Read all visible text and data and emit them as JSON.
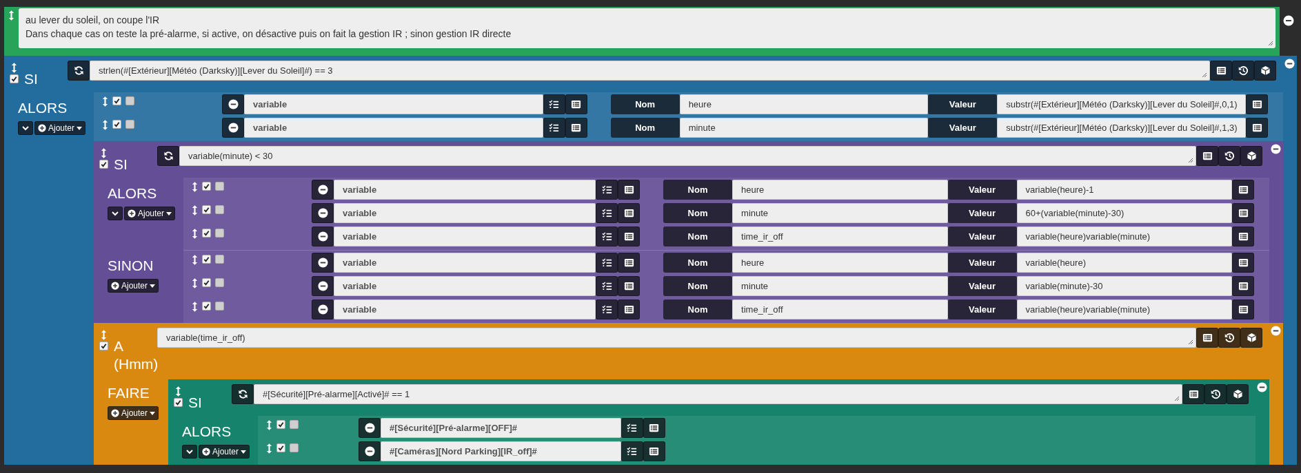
{
  "blocks": [
    {
      "kind": "comment",
      "color": "#27a35a",
      "lines": [
        "au lever du soleil, on coupe l'IR",
        "Dans chaque cas on teste la pré-alarme, si active, on désactive puis on fait la gestion IR ; sinon gestion IR directe"
      ]
    },
    {
      "kind": "if",
      "color": "#236c9e",
      "label": "SI",
      "enabled": true,
      "expression": "strlen(#[Extérieur][Météo (Darksky)][Lever du Soleil]#) == 3",
      "sections": [
        {
          "label": "ALORS",
          "collapse_button": true,
          "add_button": "Ajouter",
          "items": [
            {
              "kind": "action",
              "enabled": true,
              "parallel": false,
              "command": "variable",
              "name_label": "Nom",
              "name": "heure",
              "value_label": "Valeur",
              "value": "substr(#[Extérieur][Météo (Darksky)][Lever du Soleil]#,0,1)"
            },
            {
              "kind": "action",
              "enabled": true,
              "parallel": false,
              "command": "variable",
              "name_label": "Nom",
              "name": "minute",
              "value_label": "Valeur",
              "value": "substr(#[Extérieur][Météo (Darksky)][Lever du Soleil]#,1,3)"
            },
            {
              "kind": "if",
              "color": "#644e96",
              "label": "SI",
              "enabled": true,
              "expression": "variable(minute) < 30",
              "sections": [
                {
                  "label": "ALORS",
                  "collapse_button": true,
                  "add_button": "Ajouter",
                  "items": [
                    {
                      "kind": "action",
                      "enabled": true,
                      "parallel": false,
                      "command": "variable",
                      "name_label": "Nom",
                      "name": "heure",
                      "value_label": "Valeur",
                      "value": "variable(heure)-1"
                    },
                    {
                      "kind": "action",
                      "enabled": true,
                      "parallel": false,
                      "command": "variable",
                      "name_label": "Nom",
                      "name": "minute",
                      "value_label": "Valeur",
                      "value": "60+(variable(minute)-30)"
                    },
                    {
                      "kind": "action",
                      "enabled": true,
                      "parallel": false,
                      "command": "variable",
                      "name_label": "Nom",
                      "name": "time_ir_off",
                      "value_label": "Valeur",
                      "value": "variable(heure)variable(minute)"
                    }
                  ]
                },
                {
                  "label": "SINON",
                  "collapse_button": false,
                  "add_button": "Ajouter",
                  "items": [
                    {
                      "kind": "action",
                      "enabled": true,
                      "parallel": false,
                      "command": "variable",
                      "name_label": "Nom",
                      "name": "heure",
                      "value_label": "Valeur",
                      "value": "variable(heure)"
                    },
                    {
                      "kind": "action",
                      "enabled": true,
                      "parallel": false,
                      "command": "variable",
                      "name_label": "Nom",
                      "name": "minute",
                      "value_label": "Valeur",
                      "value": "variable(minute)-30"
                    },
                    {
                      "kind": "action",
                      "enabled": true,
                      "parallel": false,
                      "command": "variable",
                      "name_label": "Nom",
                      "name": "time_ir_off",
                      "value_label": "Valeur",
                      "value": "variable(heure)variable(minute)"
                    }
                  ]
                }
              ]
            },
            {
              "kind": "at",
              "color": "#d98810",
              "label": "A (Hmm)",
              "enabled": true,
              "expression": "variable(time_ir_off)",
              "sections": [
                {
                  "label": "FAIRE",
                  "collapse_button": false,
                  "add_button": "Ajouter",
                  "items": [
                    {
                      "kind": "if",
                      "color": "#16846c",
                      "label": "SI",
                      "enabled": true,
                      "expression": "#[Sécurité][Pré-alarme][Activé]# == 1",
                      "sections": [
                        {
                          "label": "ALORS",
                          "collapse_button": true,
                          "add_button": "Ajouter",
                          "items": [
                            {
                              "kind": "command",
                              "enabled": true,
                              "parallel": false,
                              "command": "#[Sécurité][Pré-alarme][OFF]#"
                            },
                            {
                              "kind": "command",
                              "enabled": true,
                              "parallel": false,
                              "command": "#[Caméras][Nord Parking][IR_off]#"
                            }
                          ]
                        }
                      ]
                    }
                  ]
                }
              ]
            }
          ]
        }
      ]
    }
  ]
}
